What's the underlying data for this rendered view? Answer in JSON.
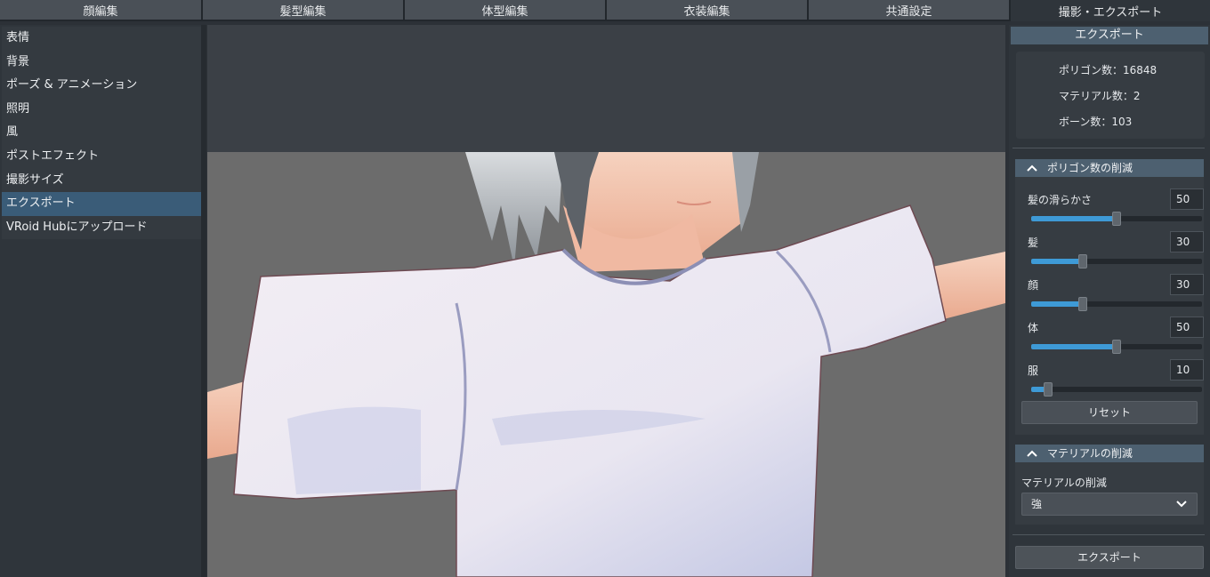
{
  "tabs": [
    {
      "label": "顔編集"
    },
    {
      "label": "髪型編集"
    },
    {
      "label": "体型編集"
    },
    {
      "label": "衣装編集"
    },
    {
      "label": "共通設定"
    },
    {
      "label": "撮影・エクスポート"
    }
  ],
  "sidebar": {
    "items": [
      {
        "label": "表情"
      },
      {
        "label": "背景"
      },
      {
        "label": "ポーズ & アニメーション"
      },
      {
        "label": "照明"
      },
      {
        "label": "風"
      },
      {
        "label": "ポストエフェクト"
      },
      {
        "label": "撮影サイズ"
      },
      {
        "label": "エクスポート"
      },
      {
        "label": "VRoid Hubにアップロード"
      }
    ]
  },
  "panel": {
    "header": "エクスポート",
    "stats": {
      "polygons": "ポリゴン数：16848",
      "materials": "マテリアル数：2",
      "bones": "ボーン数：103"
    },
    "polygon_section": {
      "title": "ポリゴン数の削減",
      "sliders": [
        {
          "label": "髪の滑らかさ",
          "value": "50",
          "level": 0.5
        },
        {
          "label": "髪",
          "value": "30",
          "level": 0.3
        },
        {
          "label": "顔",
          "value": "30",
          "level": 0.3
        },
        {
          "label": "体",
          "value": "50",
          "level": 0.5
        },
        {
          "label": "服",
          "value": "10",
          "level": 0.1
        }
      ],
      "reset_label": "リセット"
    },
    "material_section": {
      "title": "マテリアルの削減",
      "label": "マテリアルの削減",
      "selected": "強"
    },
    "export_button": "エクスポート"
  },
  "colors": {
    "accent": "#3e9ad6",
    "selected_item": "#3a5c78",
    "section_header": "#4d6070"
  }
}
